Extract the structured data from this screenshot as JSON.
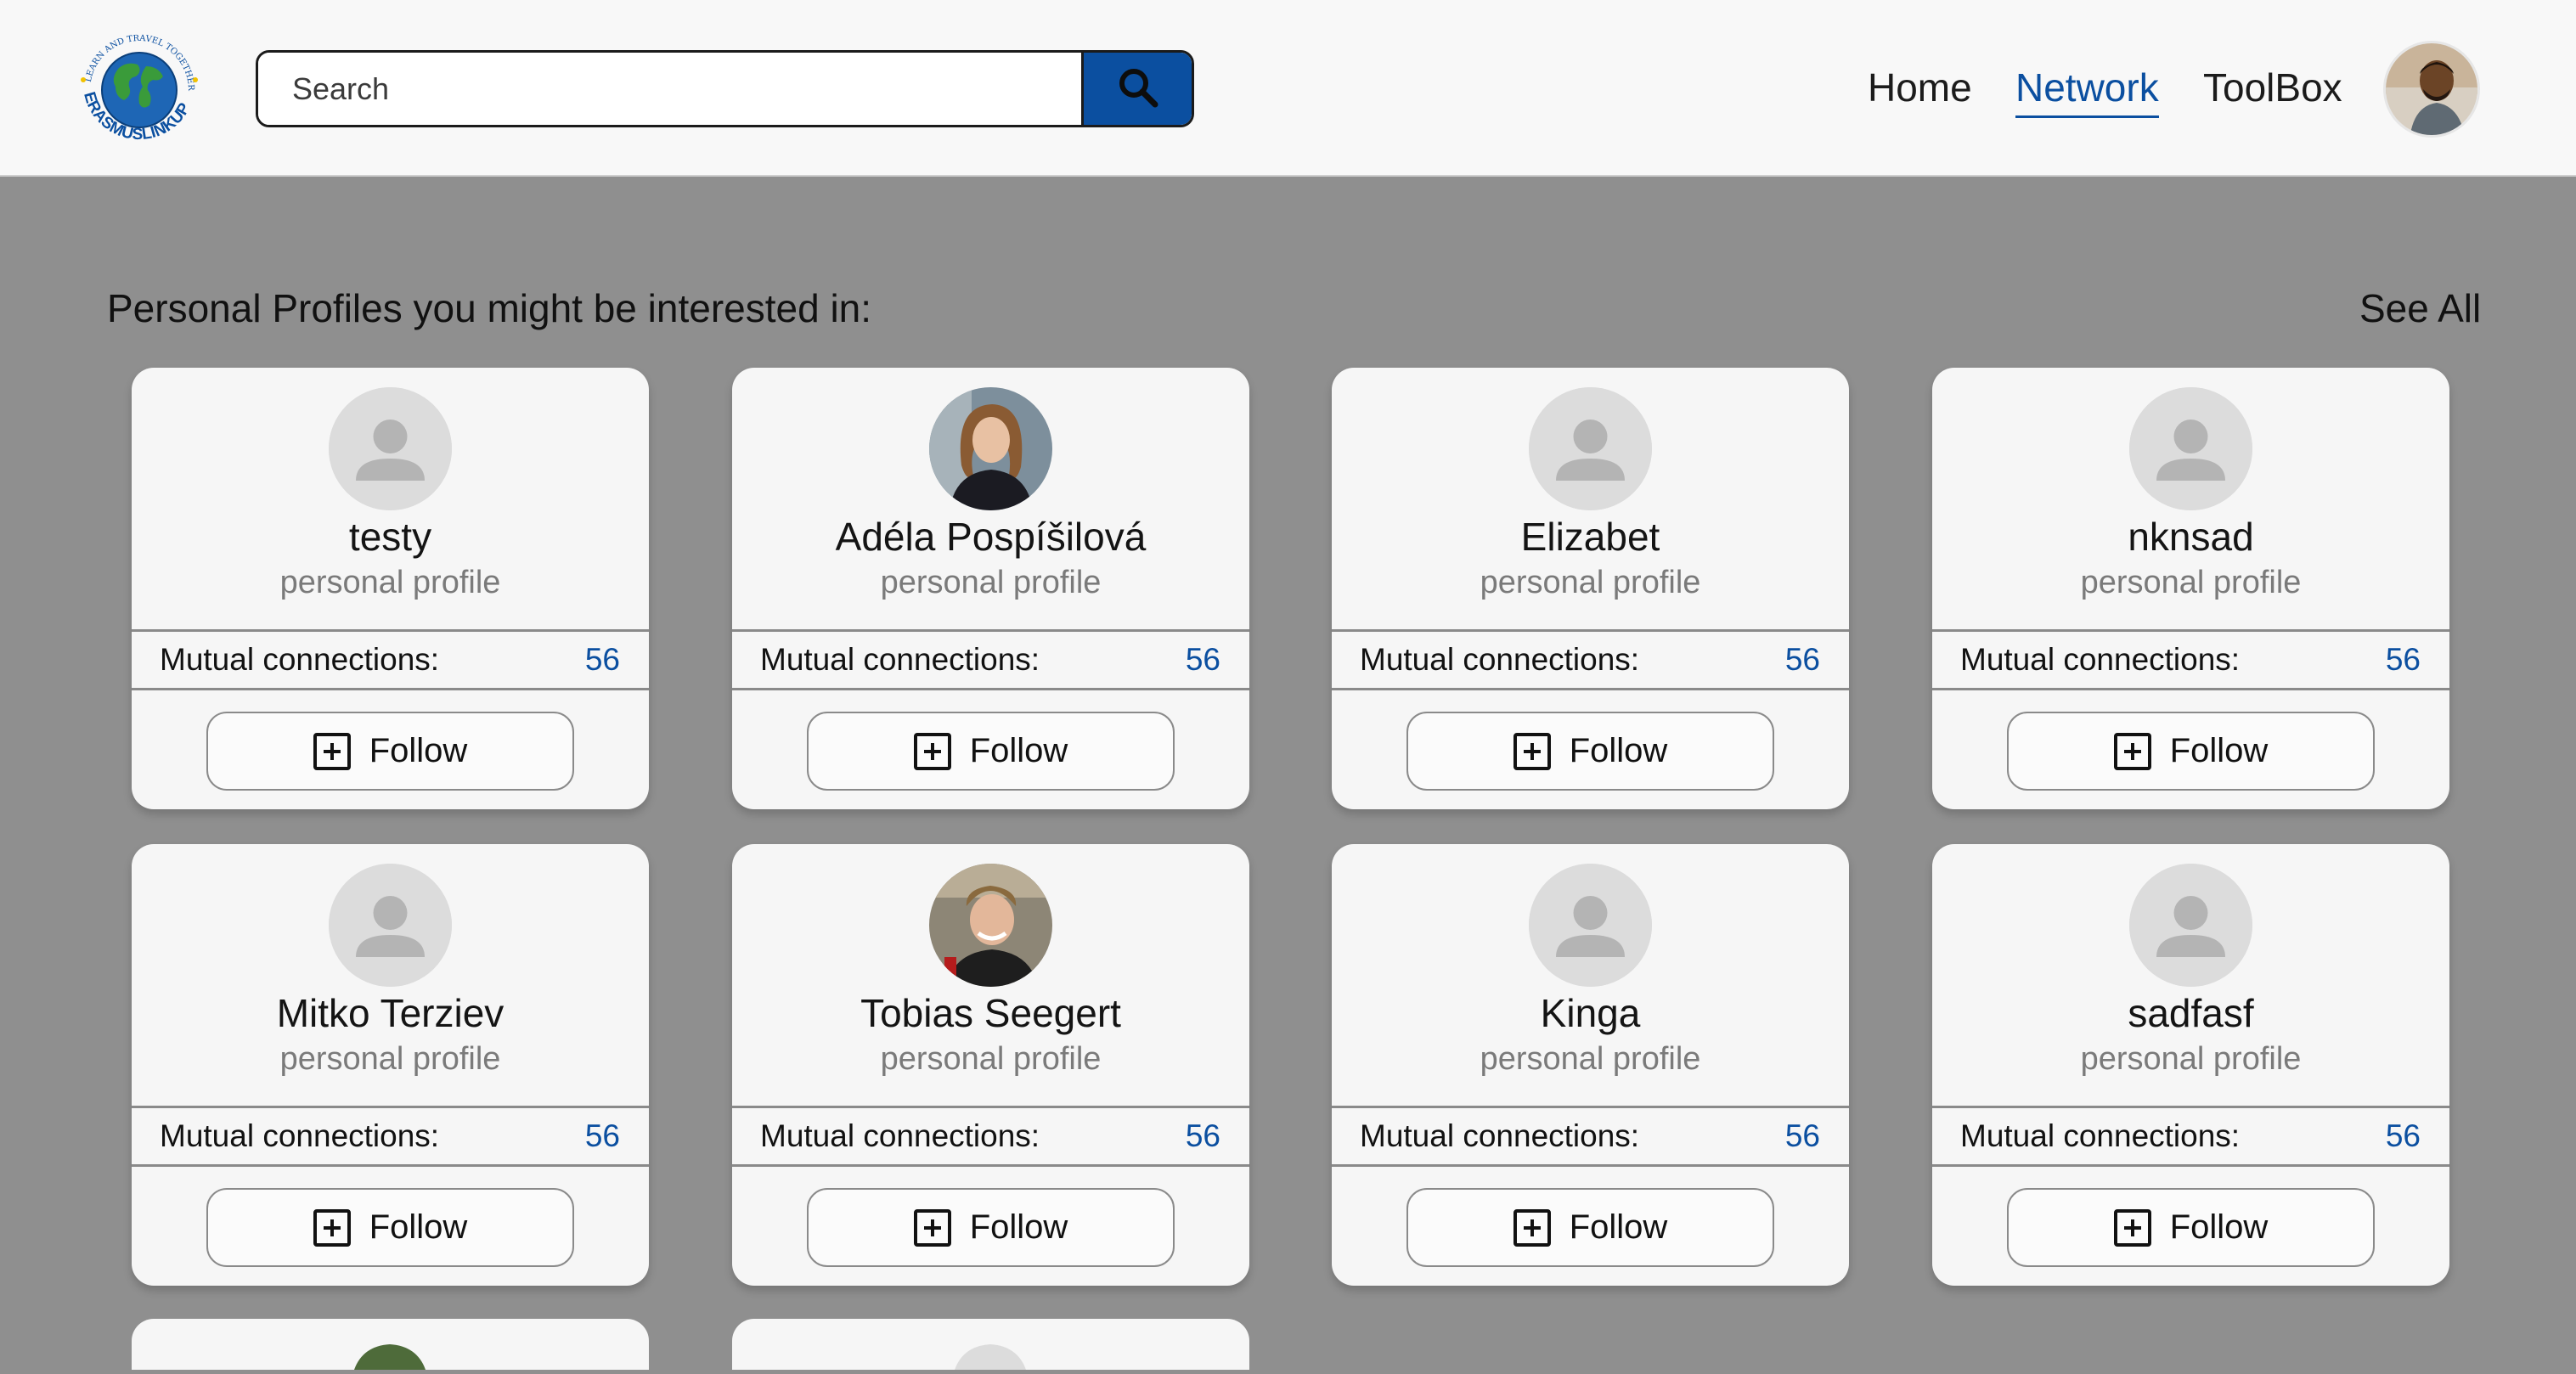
{
  "header": {
    "logo_top_text": "LEARN AND TRAVEL TOGETHER",
    "logo_brand": "ERASMUSLINKUP",
    "search_placeholder": "Search",
    "search_icon": "search-icon",
    "nav": [
      {
        "label": "Home",
        "active": false
      },
      {
        "label": "Network",
        "active": true
      },
      {
        "label": "ToolBox",
        "active": false
      }
    ]
  },
  "colors": {
    "accent": "#0b4fa0",
    "page_bg": "#8f8f8f",
    "card_bg": "#f6f6f6"
  },
  "section": {
    "title": "Personal Profiles you might be interested in:",
    "see_all": "See All"
  },
  "cards": [
    {
      "name": "testy",
      "subtitle": "personal profile",
      "mutual_label": "Mutual connections:",
      "mutual_count": "56",
      "follow_label": "Follow",
      "avatar": "default-avatar-icon"
    },
    {
      "name": "Adéla Pospíšilová",
      "subtitle": "personal profile",
      "mutual_label": "Mutual connections:",
      "mutual_count": "56",
      "follow_label": "Follow",
      "avatar": "photo"
    },
    {
      "name": "Elizabet",
      "subtitle": "personal profile",
      "mutual_label": "Mutual connections:",
      "mutual_count": "56",
      "follow_label": "Follow",
      "avatar": "default-avatar-icon"
    },
    {
      "name": "nknsad",
      "subtitle": "personal profile",
      "mutual_label": "Mutual connections:",
      "mutual_count": "56",
      "follow_label": "Follow",
      "avatar": "default-avatar-icon"
    },
    {
      "name": "Mitko Terziev",
      "subtitle": "personal profile",
      "mutual_label": "Mutual connections:",
      "mutual_count": "56",
      "follow_label": "Follow",
      "avatar": "default-avatar-icon"
    },
    {
      "name": "Tobias Seegert",
      "subtitle": "personal profile",
      "mutual_label": "Mutual connections:",
      "mutual_count": "56",
      "follow_label": "Follow",
      "avatar": "photo"
    },
    {
      "name": "Kinga",
      "subtitle": "personal profile",
      "mutual_label": "Mutual connections:",
      "mutual_count": "56",
      "follow_label": "Follow",
      "avatar": "default-avatar-icon"
    },
    {
      "name": "sadfasf",
      "subtitle": "personal profile",
      "mutual_label": "Mutual connections:",
      "mutual_count": "56",
      "follow_label": "Follow",
      "avatar": "default-avatar-icon"
    }
  ]
}
